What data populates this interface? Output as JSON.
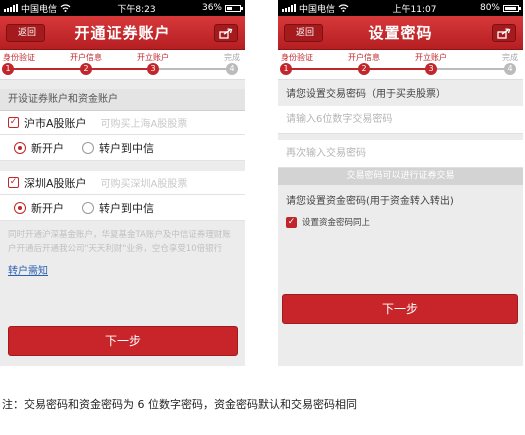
{
  "screen1": {
    "status": {
      "carrier": "中国电信",
      "time": "下午8:23",
      "battery": "36%",
      "battery_level": 0.36
    },
    "nav": {
      "back": "返回",
      "title": "开通证券账户"
    },
    "steps": [
      "身份验证",
      "开户信息",
      "开立账户",
      "完成"
    ],
    "section_title": "开设证券账户和资金账户",
    "accounts": [
      {
        "name": "沪市A股账户",
        "hint": "可购买上海A股股票",
        "opt_new": "新开户",
        "opt_transfer": "转户到中信"
      },
      {
        "name": "深圳A股账户",
        "hint": "可购买深圳A股股票",
        "opt_new": "新开户",
        "opt_transfer": "转户到中信"
      }
    ],
    "note": "同时开通沪深基金账户，华夏基金TA账户及中信证券理财账户开通后开通我公司\"天天利财\"业务，空仓享受10倍银行",
    "link": "转户需知",
    "next": "下一步"
  },
  "screen2": {
    "status": {
      "carrier": "中国电信",
      "time": "上午11:07",
      "battery": "80%",
      "battery_level": 0.8
    },
    "nav": {
      "back": "返回",
      "title": "设置密码"
    },
    "steps": [
      "身份验证",
      "开户信息",
      "开立账户",
      "完成"
    ],
    "trade_label": "请您设置交易密码（用于买卖股票）",
    "trade_placeholder_1": "请输入6位数字交易密码",
    "trade_placeholder_2": "再次输入交易密码",
    "banner": "交易密码可以进行证券交易",
    "fund_label": "请您设置资金密码(用于资金转入转出)",
    "same_check": "设置资金密码同上",
    "next": "下一步"
  },
  "footnote": "注：交易密码和资金密码为 6 位数字密码，资金密码默认和交易密码相同",
  "colors": {
    "brand": "#c0262a"
  }
}
